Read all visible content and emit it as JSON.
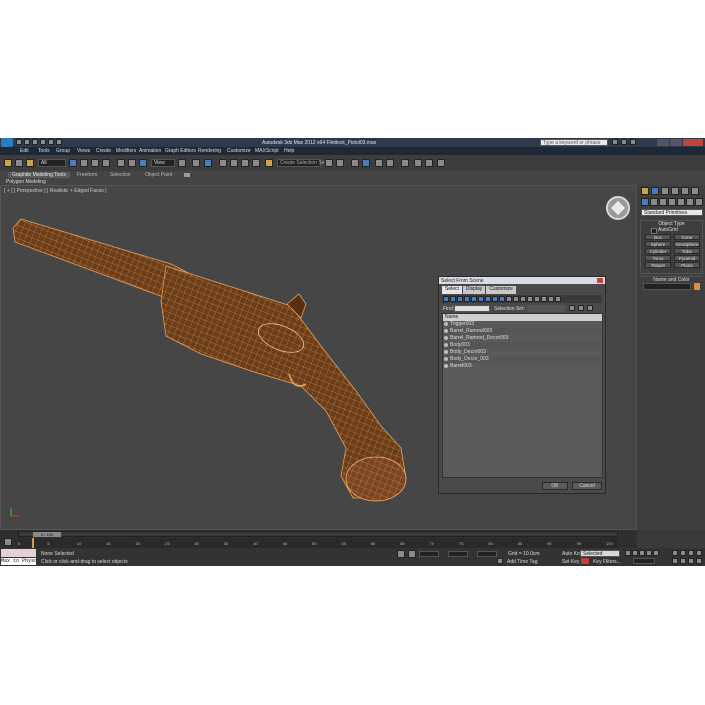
{
  "window": {
    "title": "Autodesk 3ds Max 2012 x64    Flintlock_Pistol03.max",
    "search_placeholder": "Type a keyword or phrase"
  },
  "menu": [
    "Edit",
    "Tools",
    "Group",
    "Views",
    "Create",
    "Modifiers",
    "Animation",
    "Graph Editors",
    "Rendering",
    "Customize",
    "MAXScript",
    "Help"
  ],
  "toolbar": {
    "selection_filter": "All",
    "reference_coord": "View",
    "named_selection": "Create Selection Se"
  },
  "ribbon": {
    "tabs": [
      "Graphite Modeling Tools",
      "Freeform",
      "Selection",
      "Object Paint"
    ],
    "sub_label": "Polygon Modeling"
  },
  "viewport": {
    "label": "[ + ] [ Perspective ] [ Realistic + Edged Faces ]"
  },
  "dialog": {
    "title": "Select From Scene",
    "tabs": [
      "Select",
      "Display",
      "Customize"
    ],
    "find_label": "Find:",
    "selection_set_label": "Selection Set:",
    "column_header": "Name",
    "items": [
      "Trigger003",
      "Barrel_Ramrod003",
      "Barrel_Ramrod_Decor003",
      "Body003",
      "Body_Decor003",
      "Body_Decor_003",
      "Barrel003"
    ],
    "ok_label": "OK",
    "cancel_label": "Cancel"
  },
  "command_panel": {
    "category": "Standard Primitives",
    "object_type_header": "Object Type",
    "autogrid_label": "AutoGrid",
    "buttons": [
      "Box",
      "Cone",
      "Sphere",
      "GeoSphere",
      "Cylinder",
      "Tube",
      "Torus",
      "Pyramid",
      "Teapot",
      "Plane"
    ],
    "name_color_header": "Name and Color"
  },
  "timeline": {
    "frame_display": "0 / 100",
    "ticks": [
      "0",
      "5",
      "10",
      "15",
      "20",
      "25",
      "30",
      "35",
      "40",
      "45",
      "50",
      "55",
      "60",
      "65",
      "70",
      "75",
      "80",
      "85",
      "90",
      "95",
      "100"
    ]
  },
  "status": {
    "maxscript_label": "Max to Physc",
    "selection_status": "None Selected",
    "prompt": "Click or click-and-drag to select objects",
    "grid": "Grid = 10.0cm",
    "add_time_tag": "Add Time Tag",
    "auto_key": "Auto Key",
    "selected": "Selected",
    "set_key": "Set Key",
    "key_filters": "Key Filters..."
  },
  "colors": {
    "model_wire": "#e0a060",
    "model_base": "#6b3d18",
    "accent_blue": "#4a7bc1"
  }
}
